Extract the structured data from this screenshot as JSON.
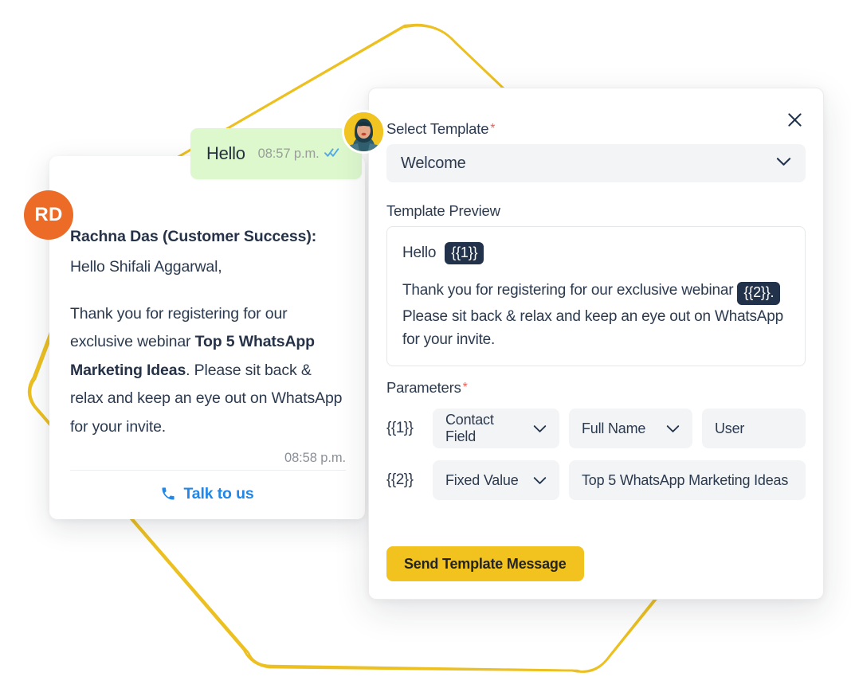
{
  "decor": {
    "line_color": "#ecc020"
  },
  "chat": {
    "incoming_bubble": {
      "text": "Hello",
      "time": "08:57 p.m.",
      "read_status_icon": "double-check-icon",
      "bubble_color": "#ddf8cd"
    },
    "avatar_photo": {
      "icon": "user-photo-avatar",
      "background": "#f2c421"
    },
    "agent_avatar": {
      "initials": "RD",
      "background": "#ec6b26"
    },
    "message": {
      "sender": "Rachna Das (Customer Success):",
      "greeting": "Hello Shifali Aggarwal,",
      "body_before_bold": "Thank you for registering for our exclusive webinar ",
      "body_bold": "Top 5 WhatsApp Marketing Ideas",
      "body_after_bold": ". Please sit back & relax and keep an eye out on WhatsApp for your invite.",
      "time": "08:58 p.m."
    },
    "footer": {
      "phone_icon": "phone-icon",
      "label": "Talk to us",
      "color": "#2286e6"
    }
  },
  "panel": {
    "close_icon": "close-icon",
    "select_template": {
      "label": "Select Template",
      "required_mark": "*",
      "value": "Welcome",
      "chevron_icon": "chevron-down-icon"
    },
    "template_preview": {
      "label": "Template Preview",
      "line1_text": "Hello",
      "line1_token": "{{1}}",
      "para_before_token": "Thank you for registering for our exclusive webinar ",
      "para_token": "{{2}}.",
      "para_after_token": " Please sit back & relax and keep an eye out on WhatsApp for your invite.",
      "token_color": "#22324a"
    },
    "parameters": {
      "label": "Parameters",
      "required_mark": "*",
      "rows": [
        {
          "key": "{{1}}",
          "type": "Contact Field",
          "field": "Full Name",
          "value": "User"
        },
        {
          "key": "{{2}}",
          "type": "Fixed Value",
          "value": "Top 5 WhatsApp Marketing Ideas"
        }
      ]
    },
    "send_button": {
      "label": "Send Template Message",
      "color": "#f2c31f"
    }
  }
}
